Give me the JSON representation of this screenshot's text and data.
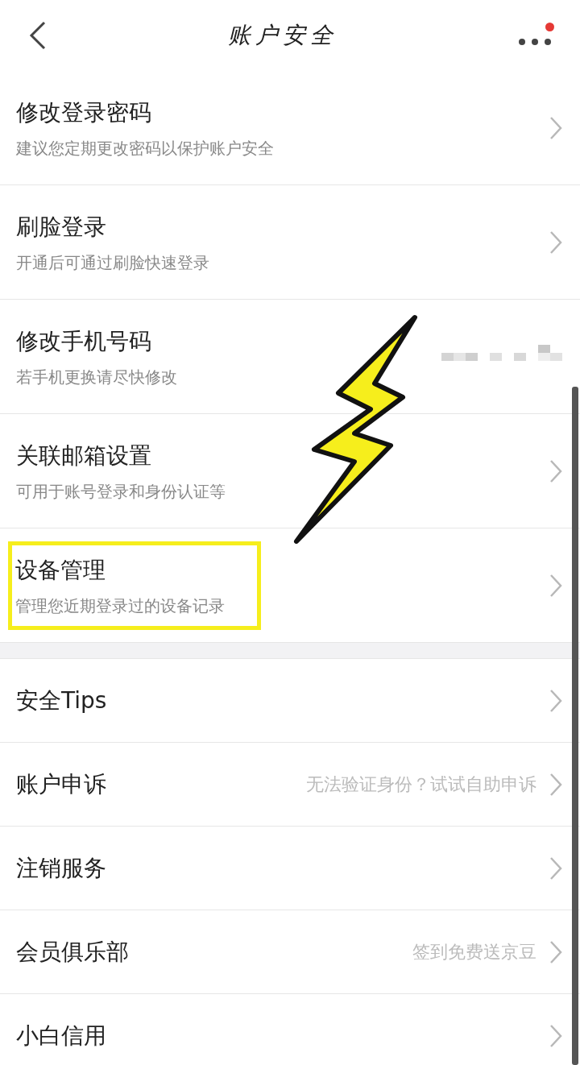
{
  "header": {
    "title": "账户安全",
    "notification_dot": true
  },
  "sections": [
    {
      "rows": [
        {
          "title": "修改登录密码",
          "subtitle": "建议您定期更改密码以保护账户安全",
          "highlighted": false,
          "value_masked": false
        },
        {
          "title": "刷脸登录",
          "subtitle": "开通后可通过刷脸快速登录",
          "highlighted": false,
          "value_masked": false
        },
        {
          "title": "修改手机号码",
          "subtitle": "若手机更换请尽快修改",
          "highlighted": false,
          "value_masked": true
        },
        {
          "title": "关联邮箱设置",
          "subtitle": "可用于账号登录和身份认证等",
          "highlighted": false,
          "value_masked": false
        },
        {
          "title": "设备管理",
          "subtitle": "管理您近期登录过的设备记录",
          "highlighted": true,
          "value_masked": false
        }
      ]
    },
    {
      "rows": [
        {
          "title": "安全Tips"
        },
        {
          "title": "账户申诉",
          "hint": "无法验证身份？试试自助申诉"
        },
        {
          "title": "注销服务"
        },
        {
          "title": "会员俱乐部",
          "hint": "签到免费送京豆"
        },
        {
          "title": "小白信用"
        }
      ]
    }
  ]
}
